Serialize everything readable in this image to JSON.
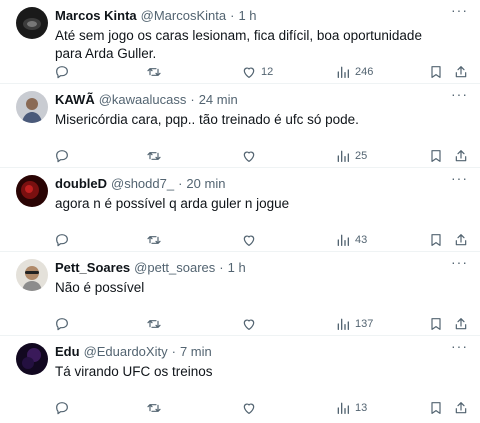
{
  "tweets": [
    {
      "name": "Marcos Kinta",
      "handle": "@MarcosKinta",
      "sep": "·",
      "time": "1 h",
      "text": "Até sem jogo os caras lesionam, fica difícil, boa oportunidade para Arda Guller.",
      "likes": "12",
      "views": "246",
      "avatar_color": "#1a1a1a"
    },
    {
      "name": "KAWÃ",
      "handle": "@kawaalucass",
      "sep": "·",
      "time": "24 min",
      "text": "Misericórdia cara, pqp.. tão treinado é ufc só pode.",
      "likes": "",
      "views": "25",
      "avatar_color": "#5a6a8a"
    },
    {
      "name": "doubleD",
      "handle": "@shodd7_",
      "sep": "·",
      "time": "20 min",
      "text": "agora n é possível q arda guler n jogue",
      "likes": "",
      "views": "43",
      "avatar_color": "#3a0606"
    },
    {
      "name": "Pett_Soares",
      "handle": "@pett_soares",
      "sep": "·",
      "time": "1 h",
      "text": "Não é possível",
      "likes": "",
      "views": "137",
      "avatar_color": "#d9d6cf"
    },
    {
      "name": "Edu",
      "handle": "@EduardoXity",
      "sep": "·",
      "time": "7 min",
      "text": "Tá virando UFC os treinos",
      "likes": "",
      "views": "13",
      "avatar_color": "#160a26"
    }
  ],
  "icons": {
    "reply": "reply-icon",
    "retweet": "retweet-icon",
    "like": "like-icon",
    "views": "views-icon",
    "bookmark": "bookmark-icon",
    "share": "share-icon",
    "more": "more-icon"
  },
  "colors": {
    "text": "#0f1419",
    "secondary": "#536471",
    "divider": "#eff3f4"
  }
}
